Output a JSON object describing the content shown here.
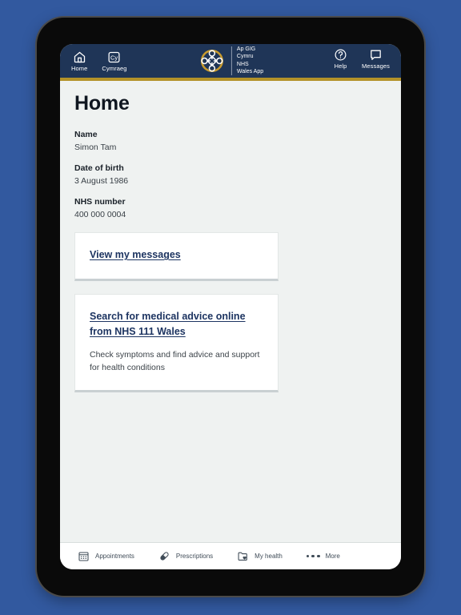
{
  "topnav": {
    "left_items": [
      {
        "label": "Home",
        "icon": "home-icon"
      },
      {
        "label": "Cymraeg",
        "icon": "welsh-language-icon"
      }
    ],
    "right_items": [
      {
        "label": "Help",
        "icon": "help-circle-icon"
      },
      {
        "label": "Messages",
        "icon": "speech-bubble-icon"
      }
    ],
    "brand": {
      "logo_icon": "nhs-wales-celtic-knot-logo",
      "line1": "Ap GIG",
      "line2": "Cymru",
      "line3": "NHS",
      "line4": "Wales App"
    },
    "background_color": "#1f3557",
    "accent_bar_color": "#b39229"
  },
  "main": {
    "page_title": "Home",
    "fields": [
      {
        "label": "Name",
        "value": "Simon Tam"
      },
      {
        "label": "Date of birth",
        "value": "3 August 1986"
      },
      {
        "label": "NHS number",
        "value": "400 000 0004"
      }
    ],
    "cards": [
      {
        "link": "View my messages",
        "description": ""
      },
      {
        "link": "Search for medical advice online from NHS 111 Wales",
        "description": "Check symptoms and find advice and support for health conditions"
      }
    ],
    "link_color": "#1d3461",
    "background_color": "#eff2f1"
  },
  "bottomnav": {
    "items": [
      {
        "label": "Appointments",
        "icon": "calendar-icon"
      },
      {
        "label": "Prescriptions",
        "icon": "pill-icon"
      },
      {
        "label": "My health",
        "icon": "folder-heart-icon"
      },
      {
        "label": "More",
        "icon": "ellipsis-icon"
      }
    ]
  },
  "device": {
    "page_background_color": "#32599f",
    "bezel_color": "#0a0a0a"
  }
}
